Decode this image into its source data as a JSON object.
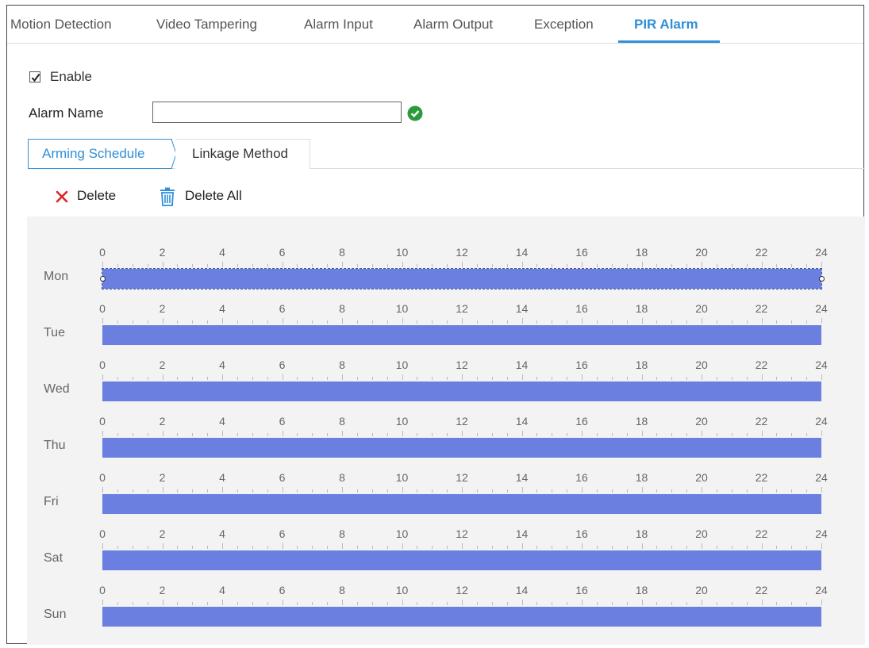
{
  "tabs": [
    {
      "label": "Motion Detection",
      "active": false
    },
    {
      "label": "Video Tampering",
      "active": false
    },
    {
      "label": "Alarm Input",
      "active": false
    },
    {
      "label": "Alarm Output",
      "active": false
    },
    {
      "label": "Exception",
      "active": false
    },
    {
      "label": "PIR Alarm",
      "active": true
    }
  ],
  "enable": {
    "label": "Enable",
    "checked": true
  },
  "alarm_name": {
    "label": "Alarm Name",
    "value": "",
    "valid_icon": "check-circle-icon"
  },
  "subtabs": [
    {
      "label": "Arming Schedule",
      "active": true
    },
    {
      "label": "Linkage Method",
      "active": false
    }
  ],
  "toolbar": {
    "delete_label": "Delete",
    "delete_all_label": "Delete All",
    "delete_icon": "x-icon",
    "delete_all_icon": "trash-icon"
  },
  "schedule": {
    "ticks": [
      "0",
      "2",
      "4",
      "6",
      "8",
      "10",
      "12",
      "14",
      "16",
      "18",
      "20",
      "22",
      "24"
    ],
    "days": [
      {
        "label": "Mon",
        "start": 0,
        "end": 24,
        "selected": true
      },
      {
        "label": "Tue",
        "start": 0,
        "end": 24,
        "selected": false
      },
      {
        "label": "Wed",
        "start": 0,
        "end": 24,
        "selected": false
      },
      {
        "label": "Thu",
        "start": 0,
        "end": 24,
        "selected": false
      },
      {
        "label": "Fri",
        "start": 0,
        "end": 24,
        "selected": false
      },
      {
        "label": "Sat",
        "start": 0,
        "end": 24,
        "selected": false
      },
      {
        "label": "Sun",
        "start": 0,
        "end": 24,
        "selected": false
      }
    ]
  },
  "colors": {
    "accent": "#2f8fd8",
    "bar": "#6a7fe0",
    "ok": "#2a9a3c",
    "delete": "#e02424",
    "trash": "#2f8fd8"
  }
}
